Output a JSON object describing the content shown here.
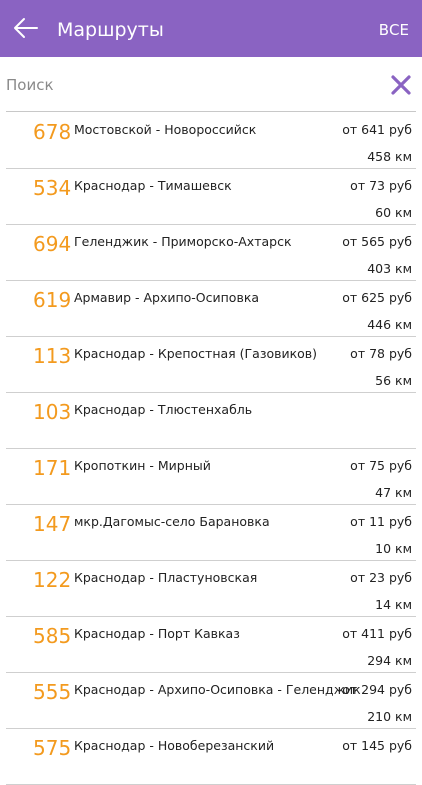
{
  "appbar": {
    "title": "Маршруты",
    "all_label": "ВСЕ",
    "color": "#8a63c2"
  },
  "search": {
    "placeholder": "Поиск",
    "value": ""
  },
  "accent": {
    "route_number": "#f39a1e",
    "clear_icon": "#8a63c2"
  },
  "routes": [
    {
      "number": "678",
      "name": "Мостовской - Новороссийск",
      "price": "от 641 руб",
      "distance": "458 км"
    },
    {
      "number": "534",
      "name": "Краснодар - Тимашевск",
      "price": "от 73 руб",
      "distance": "60 км"
    },
    {
      "number": "694",
      "name": "Геленджик - Приморско-Ахтарск",
      "price": "от 565 руб",
      "distance": "403 км"
    },
    {
      "number": "619",
      "name": "Армавир - Архипо-Осиповка",
      "price": "от 625 руб",
      "distance": "446 км"
    },
    {
      "number": "113",
      "name": "Краснодар - Крепостная (Газовиков)",
      "price": "от 78 руб",
      "distance": "56 км"
    },
    {
      "number": "103",
      "name": "Краснодар - Тлюстенхабль",
      "price": "",
      "distance": ""
    },
    {
      "number": "171",
      "name": "Кропоткин - Мирный",
      "price": "от 75 руб",
      "distance": "47 км"
    },
    {
      "number": "147",
      "name": "мкр.Дагомыс-село Барановка",
      "price": "от 11 руб",
      "distance": "10 км"
    },
    {
      "number": "122",
      "name": "Краснодар - Пластуновская",
      "price": "от 23 руб",
      "distance": "14 км"
    },
    {
      "number": "585",
      "name": "Краснодар - Порт Кавказ",
      "price": "от 411 руб",
      "distance": "294 км"
    },
    {
      "number": "555",
      "name": "Краснодар - Архипо-Осиповка - Геленджик",
      "price": "от 294 руб",
      "distance": "210 км"
    },
    {
      "number": "575",
      "name": "Краснодар - Новоберезанский",
      "price": "от 145 руб",
      "distance": ""
    }
  ]
}
